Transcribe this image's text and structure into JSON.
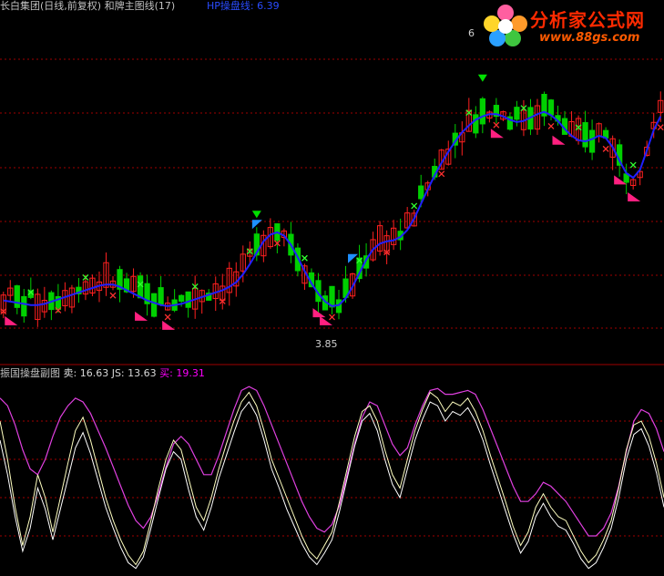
{
  "header": {
    "main_title": "长白集团(日线,前复权) 和牌主图线(17)",
    "hp_label": "HP操盘线: 6.39",
    "sub_title_name": "振国操盘副图",
    "sell_label": "卖: 16.63",
    "js_label": "JS: 13.63",
    "buy_label": "买: 19.31"
  },
  "annotations": {
    "low_price": "3.85",
    "high_price": "6"
  },
  "logo": {
    "brand": "分析家公式网",
    "url": "www.88gs.com"
  },
  "colors": {
    "background": "#000000",
    "up_candle": "#ff2020",
    "down_candle": "#00d000",
    "ma_line": "#2020ff",
    "grid": "#a00000",
    "sell_line": "#ffffc0",
    "js_line": "#ffffff",
    "buy_line": "#e040e0",
    "buy_marker": "#ff2080",
    "sell_marker_top": "#00e000",
    "flag_blue": "#1e90ff",
    "cross_green": "#30ff30",
    "cross_red": "#ff3030"
  },
  "chart_data": [
    {
      "type": "candlestick",
      "ylim": [
        3.6,
        6.6
      ],
      "ma_series": [
        4.1,
        4.09,
        4.08,
        4.07,
        4.06,
        4.06,
        4.07,
        4.09,
        4.11,
        4.13,
        4.15,
        4.17,
        4.19,
        4.21,
        4.23,
        4.24,
        4.24,
        4.22,
        4.19,
        4.16,
        4.13,
        4.1,
        4.08,
        4.06,
        4.05,
        4.06,
        4.07,
        4.09,
        4.11,
        4.13,
        4.15,
        4.17,
        4.19,
        4.22,
        4.26,
        4.33,
        4.42,
        4.52,
        4.62,
        4.68,
        4.7,
        4.67,
        4.59,
        4.48,
        4.36,
        4.25,
        4.16,
        4.09,
        4.05,
        4.06,
        4.12,
        4.22,
        4.34,
        4.46,
        4.55,
        4.6,
        4.62,
        4.63,
        4.66,
        4.72,
        4.82,
        4.95,
        5.08,
        5.2,
        5.31,
        5.41,
        5.5,
        5.58,
        5.64,
        5.69,
        5.72,
        5.74,
        5.74,
        5.72,
        5.69,
        5.67,
        5.68,
        5.71,
        5.74,
        5.76,
        5.73,
        5.68,
        5.61,
        5.55,
        5.51,
        5.5,
        5.52,
        5.55,
        5.53,
        5.45,
        5.33,
        5.22,
        5.18,
        5.25,
        5.42,
        5.6,
        5.72
      ],
      "ma_value_label": "6.39",
      "markers": [
        {
          "kind": "buy",
          "i": 1
        },
        {
          "kind": "buy",
          "i": 20
        },
        {
          "kind": "buy",
          "i": 24
        },
        {
          "kind": "buy",
          "i": 46
        },
        {
          "kind": "buy",
          "i": 47
        },
        {
          "kind": "buy",
          "i": 72
        },
        {
          "kind": "buy",
          "i": 81
        },
        {
          "kind": "buy",
          "i": 90
        },
        {
          "kind": "buy",
          "i": 92
        },
        {
          "kind": "flag",
          "i": 37
        },
        {
          "kind": "flag",
          "i": 51
        },
        {
          "kind": "top",
          "i": 37
        },
        {
          "kind": "top",
          "i": 70
        }
      ]
    },
    {
      "type": "line",
      "ylim": [
        0,
        100
      ],
      "series_names": [
        "卖",
        "JS",
        "买"
      ],
      "sell": [
        80,
        60,
        35,
        15,
        30,
        52,
        40,
        22,
        40,
        58,
        75,
        82,
        70,
        55,
        40,
        28,
        18,
        10,
        5,
        12,
        28,
        45,
        60,
        70,
        65,
        50,
        35,
        28,
        40,
        55,
        68,
        80,
        90,
        95,
        88,
        75,
        60,
        50,
        40,
        30,
        20,
        12,
        8,
        15,
        22,
        38,
        55,
        72,
        85,
        88,
        80,
        65,
        52,
        45,
        60,
        75,
        86,
        95,
        92,
        85,
        90,
        88,
        92,
        85,
        75,
        62,
        50,
        38,
        25,
        15,
        22,
        35,
        42,
        35,
        30,
        28,
        20,
        12,
        6,
        10,
        18,
        28,
        45,
        65,
        78,
        80,
        72,
        58,
        40
      ],
      "js": [
        70,
        52,
        30,
        12,
        24,
        45,
        34,
        18,
        34,
        50,
        66,
        74,
        63,
        49,
        35,
        24,
        14,
        6,
        3,
        9,
        24,
        40,
        55,
        64,
        60,
        44,
        30,
        23,
        35,
        50,
        62,
        74,
        85,
        90,
        83,
        70,
        55,
        45,
        34,
        25,
        16,
        9,
        5,
        11,
        18,
        33,
        50,
        67,
        80,
        84,
        75,
        60,
        47,
        40,
        55,
        70,
        81,
        90,
        88,
        80,
        85,
        83,
        87,
        80,
        70,
        57,
        45,
        33,
        21,
        11,
        17,
        30,
        37,
        30,
        25,
        23,
        16,
        8,
        3,
        6,
        14,
        24,
        40,
        60,
        73,
        76,
        67,
        53,
        35
      ],
      "buy": [
        92,
        88,
        78,
        65,
        55,
        52,
        60,
        72,
        82,
        88,
        92,
        90,
        84,
        75,
        66,
        56,
        46,
        36,
        28,
        24,
        30,
        42,
        56,
        68,
        72,
        68,
        60,
        52,
        52,
        62,
        74,
        86,
        96,
        98,
        96,
        88,
        78,
        68,
        58,
        48,
        38,
        30,
        24,
        22,
        26,
        36,
        52,
        68,
        82,
        90,
        88,
        78,
        68,
        62,
        66,
        78,
        88,
        96,
        97,
        94,
        94,
        95,
        96,
        94,
        86,
        76,
        66,
        56,
        46,
        38,
        38,
        42,
        48,
        46,
        42,
        38,
        32,
        26,
        20,
        20,
        24,
        32,
        46,
        64,
        80,
        86,
        84,
        76,
        64
      ],
      "grid_lines": 4
    }
  ]
}
